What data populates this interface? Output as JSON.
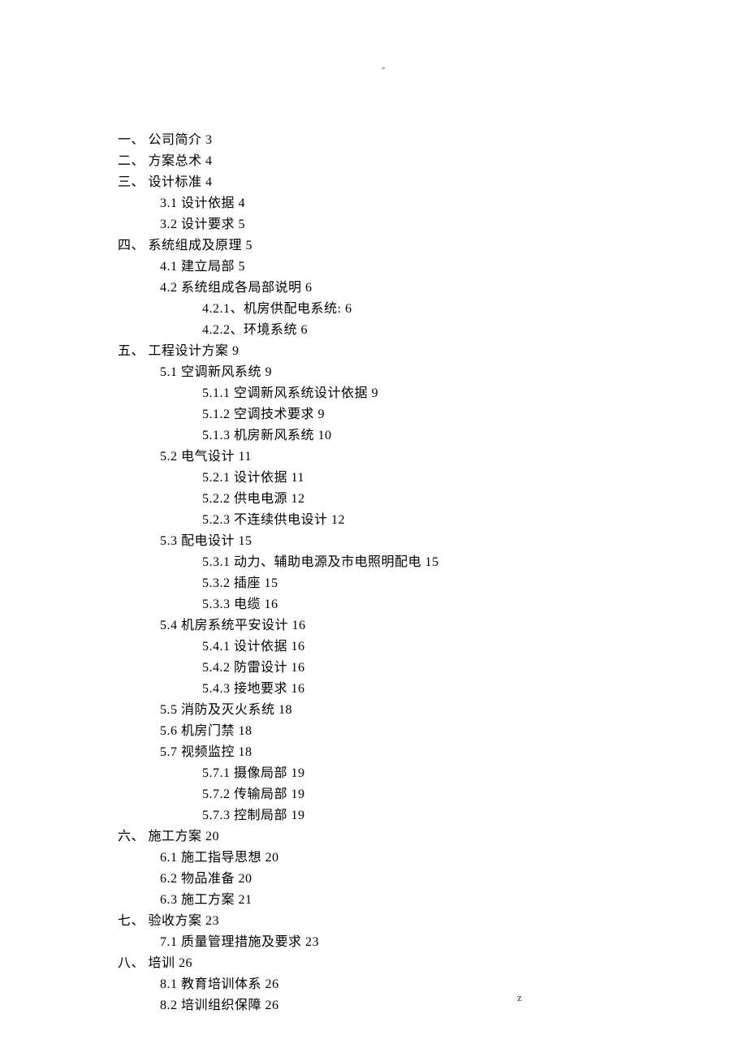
{
  "header_mark": "-",
  "footer_dot": ".",
  "footer_z": "z",
  "toc": [
    {
      "level": 0,
      "text": "一、 公司简介 3"
    },
    {
      "level": 0,
      "text": "二、 方案总术 4"
    },
    {
      "level": 0,
      "text": "三、 设计标准 4"
    },
    {
      "level": 1,
      "text": "3.1 设计依据 4"
    },
    {
      "level": 1,
      "text": "3.2 设计要求 5"
    },
    {
      "level": 0,
      "text": "四、 系统组成及原理 5"
    },
    {
      "level": 1,
      "text": "4.1 建立局部 5"
    },
    {
      "level": 1,
      "text": "4.2 系统组成各局部说明 6"
    },
    {
      "level": 2,
      "text": "4.2.1、机房供配电系统: 6"
    },
    {
      "level": 2,
      "text": "4.2.2、环境系统 6"
    },
    {
      "level": 0,
      "text": "五、 工程设计方案 9"
    },
    {
      "level": 1,
      "text": "5.1 空调新风系统 9"
    },
    {
      "level": 2,
      "text": "5.1.1 空调新风系统设计依据 9"
    },
    {
      "level": 2,
      "text": "5.1.2 空调技术要求 9"
    },
    {
      "level": 2,
      "text": "5.1.3 机房新风系统 10"
    },
    {
      "level": 1,
      "text": "5.2 电气设计 11"
    },
    {
      "level": 2,
      "text": "5.2.1 设计依据 11"
    },
    {
      "level": 2,
      "text": "5.2.2 供电电源 12"
    },
    {
      "level": 2,
      "text": "5.2.3 不连续供电设计 12"
    },
    {
      "level": 1,
      "text": "5.3 配电设计 15"
    },
    {
      "level": 2,
      "text": "5.3.1 动力、辅助电源及市电照明配电 15"
    },
    {
      "level": 2,
      "text": "5.3.2 插座 15"
    },
    {
      "level": 2,
      "text": "5.3.3 电缆 16"
    },
    {
      "level": 1,
      "text": "5.4 机房系统平安设计 16"
    },
    {
      "level": 2,
      "text": "5.4.1 设计依据 16"
    },
    {
      "level": 2,
      "text": "5.4.2 防雷设计 16"
    },
    {
      "level": 2,
      "text": "5.4.3 接地要求 16"
    },
    {
      "level": 1,
      "text": "5.5 消防及灭火系统 18"
    },
    {
      "level": 1,
      "text": "5.6 机房门禁 18"
    },
    {
      "level": 1,
      "text": "5.7 视频监控 18"
    },
    {
      "level": 2,
      "text": "5.7.1 摄像局部 19"
    },
    {
      "level": 2,
      "text": "5.7.2 传输局部 19"
    },
    {
      "level": 2,
      "text": "5.7.3 控制局部 19"
    },
    {
      "level": 0,
      "text": "六、 施工方案 20"
    },
    {
      "level": 1,
      "text": "6.1 施工指导思想 20"
    },
    {
      "level": 1,
      "text": "6.2 物品准备 20"
    },
    {
      "level": 1,
      "text": "6.3 施工方案 21"
    },
    {
      "level": 0,
      "text": "七、 验收方案 23"
    },
    {
      "level": 1,
      "text": "7.1 质量管理措施及要求 23"
    },
    {
      "level": 0,
      "text": "八、 培训 26"
    },
    {
      "level": 1,
      "text": "8.1 教育培训体系 26"
    },
    {
      "level": 1,
      "text": "8.2 培训组织保障 26"
    }
  ]
}
